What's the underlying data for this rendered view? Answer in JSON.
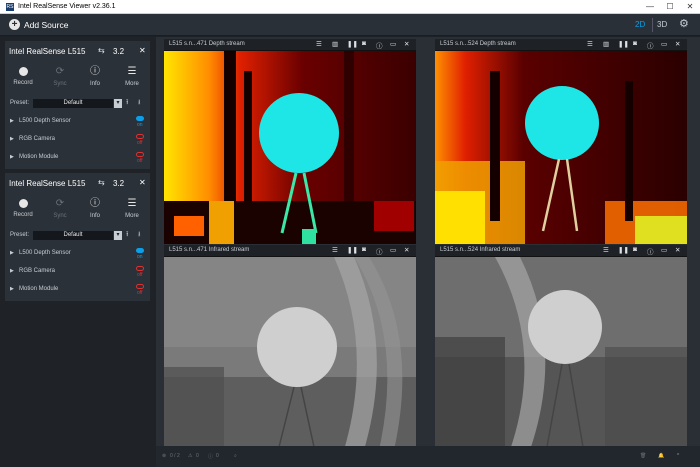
{
  "window": {
    "title": "Intel RealSense Viewer v2.36.1",
    "icon": "RS",
    "min": "—",
    "max": "☐",
    "close": "✕"
  },
  "topbar": {
    "add_source": "Add Source",
    "view_2d": "2D",
    "view_3d": "3D",
    "settings_icon": "gear-icon"
  },
  "devices": [
    {
      "name": "Intel RealSense L515",
      "usb": "3.2",
      "close": "✕",
      "actions": [
        {
          "label": "Record"
        },
        {
          "label": "Sync"
        },
        {
          "label": "Info"
        },
        {
          "label": "More"
        }
      ],
      "preset": {
        "label": "Preset:",
        "value": "Default"
      },
      "sensors": [
        {
          "name": "L500 Depth Sensor",
          "state": "on"
        },
        {
          "name": "RGB Camera",
          "state": "off"
        },
        {
          "name": "Motion Module",
          "state": "off"
        }
      ]
    },
    {
      "name": "Intel RealSense L515",
      "usb": "3.2",
      "close": "✕",
      "actions": [
        {
          "label": "Record"
        },
        {
          "label": "Sync"
        },
        {
          "label": "Info"
        },
        {
          "label": "More"
        }
      ],
      "preset": {
        "label": "Preset:",
        "value": "Default"
      },
      "sensors": [
        {
          "name": "L500 Depth Sensor",
          "state": "on"
        },
        {
          "name": "RGB Camera",
          "state": "off"
        },
        {
          "name": "Motion Module",
          "state": "off"
        }
      ]
    }
  ],
  "streams": [
    {
      "title": "L515 s.n...471 Depth stream",
      "kind": "depth"
    },
    {
      "title": "L515 s.n...524 Depth stream",
      "kind": "depth"
    },
    {
      "title": "L515 s.n...471 Infrared stream",
      "kind": "infrared"
    },
    {
      "title": "L515 s.n...524 Infrared stream",
      "kind": "infrared"
    }
  ],
  "bottombar": {
    "errors": "0 / 2",
    "warnings": "0",
    "info": "0"
  },
  "colors": {
    "accent": "#0a9fe8",
    "off": "#e03030",
    "panel": "#2b3138"
  }
}
